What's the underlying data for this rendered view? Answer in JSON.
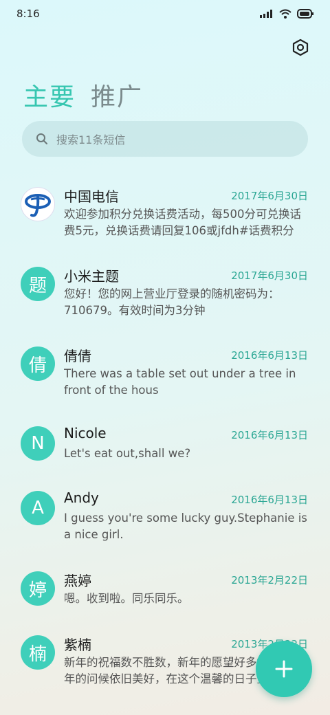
{
  "status_bar": {
    "time": "8:16",
    "icons": [
      "signal-icon",
      "wifi-icon",
      "battery-icon"
    ]
  },
  "header": {
    "settings_icon": "hexagon-settings-icon",
    "tabs": [
      {
        "label": "主要",
        "active": true
      },
      {
        "label": "推广",
        "active": false
      }
    ]
  },
  "search": {
    "placeholder": "搜索11条短信"
  },
  "colors": {
    "accent": "#36c6b0",
    "avatar": "#3fcfba",
    "date": "#2aa693"
  },
  "messages": [
    {
      "avatar": "",
      "avatar_type": "china-telecom-logo",
      "name": "中国电信",
      "date": "2017年6月30日",
      "preview": "欢迎参加积分兑换话费活动，每500分可兑换话费5元，兑换话费请回复106或jfdh#话费积分"
    },
    {
      "avatar": "题",
      "name": "小米主题",
      "date": "2017年6月30日",
      "preview": "您好！您的网上营业厅登录的随机密码为：710679。有效时间为3分钟"
    },
    {
      "avatar": "倩",
      "name": "倩倩",
      "date": "2016年6月13日",
      "preview": "There was a table set out under a tree in front of the hous"
    },
    {
      "avatar": "N",
      "name": "Nicole",
      "date": "2016年6月13日",
      "preview": "Let's eat out,shall we?"
    },
    {
      "avatar": "A",
      "name": "Andy",
      "date": "2016年6月13日",
      "preview": "I guess you're some lucky guy.Stephanie is a nice girl."
    },
    {
      "avatar": "婷",
      "name": "燕婷",
      "date": "2013年2月22日",
      "preview": "嗯。收到啦。同乐同乐。"
    },
    {
      "avatar": "楠",
      "name": "紫楠",
      "date": "2013年2月22日",
      "preview": "新年的祝福数不胜数，新年的愿望好多好多，新年的问候依旧美好，在这个温馨的日子里"
    }
  ],
  "fab": {
    "icon": "plus-icon"
  }
}
